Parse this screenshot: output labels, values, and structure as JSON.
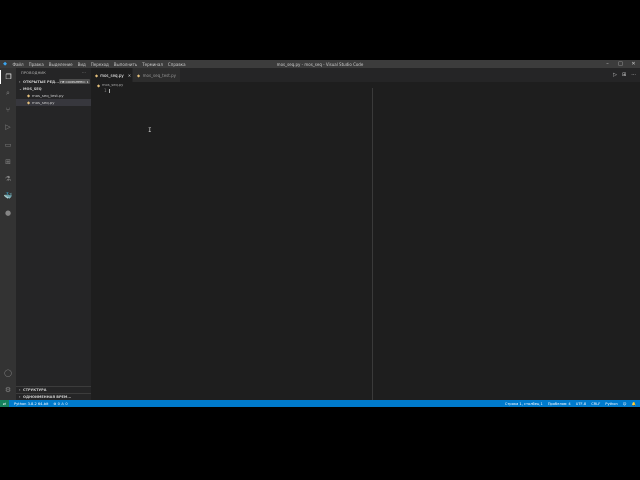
{
  "window": {
    "title": "mos_seq.py - mos_seq - Visual Studio Code",
    "menu": [
      "Файл",
      "Правка",
      "Выделение",
      "Вид",
      "Переход",
      "Выполнить",
      "Терминал",
      "Справка"
    ],
    "controls": {
      "minimize": "–",
      "maximize": "□",
      "close": "✕"
    }
  },
  "activitybar": {
    "icons": [
      "explorer-icon",
      "search-icon",
      "source-control-icon",
      "run-debug-icon",
      "remote-explorer-icon",
      "extensions-icon",
      "testing-icon",
      "docker-icon",
      "python-icon",
      "account-icon",
      "settings-gear-icon"
    ]
  },
  "sidebar": {
    "header": "ПРОВОДНИК",
    "header_action": "···",
    "open_editors_label": "ОТКРЫТЫЕ РЕД...",
    "unsaved_badge": "НЕ СОХРАНЕНО: 1",
    "folder_label": "MOS_SEQ",
    "files": [
      "mos_seq_test.py",
      "mos_seq.py"
    ],
    "outline_label": "СТРУКТУРА",
    "timeline_label": "ОДНОИМЕННАЯ ВРЕМ..."
  },
  "tabs": [
    {
      "label": "mos_seq.py",
      "close": "✕",
      "active": true
    },
    {
      "label": "mos_seq_test.py",
      "close": "",
      "active": false
    }
  ],
  "editor": {
    "breadcrumb": "mos_seq.py",
    "line_number": "1",
    "mouse_cursor": "I",
    "actions": [
      "▷",
      "⊞",
      "···"
    ]
  },
  "statusbar": {
    "remote": "⇌",
    "python": "Python 3.8.2 64-bit",
    "problems": "⊗ 0 ⚠ 0",
    "position": "Строка 1, столбец 1",
    "spaces": "Пробелов: 4",
    "encoding": "UTF-8",
    "eol": "CRLF",
    "language": "Python",
    "feedback": "☺",
    "notifications": "🔔"
  },
  "colors": {
    "accent": "#007acc",
    "remote": "#16825d",
    "titlebar": "#3c3c3c",
    "activitybar": "#333333",
    "sidebar": "#252526",
    "editor": "#1e1e1e"
  }
}
